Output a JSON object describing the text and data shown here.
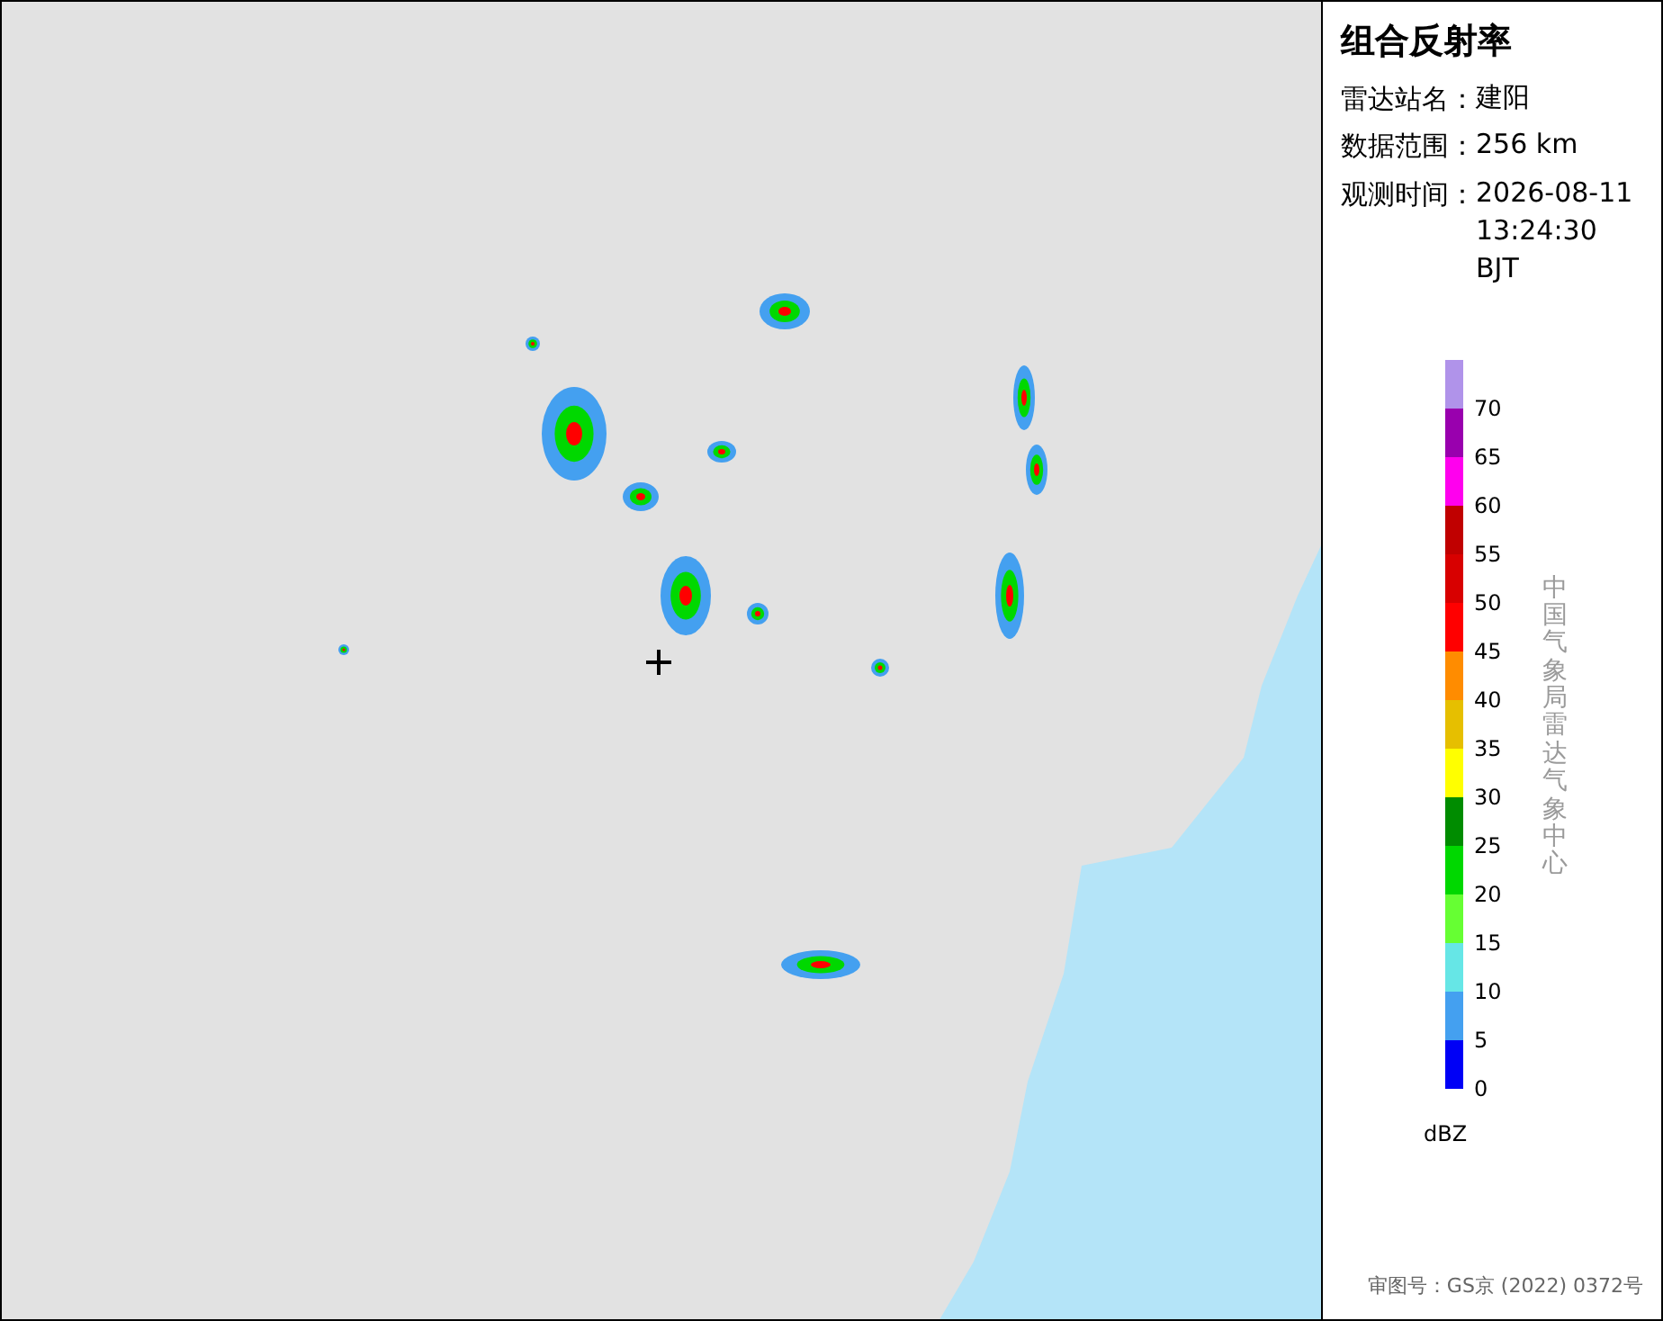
{
  "panel": {
    "title": "组合反射率",
    "fields": [
      {
        "label": "雷达站名：",
        "value": "建阳"
      },
      {
        "label": "数据范围：",
        "value": "256 km"
      },
      {
        "label": "观测时间：",
        "value": "2026-08-11 13:24:30 BJT"
      }
    ]
  },
  "legend": {
    "unit": "dBZ",
    "bins": [
      {
        "label": "70",
        "color": "#b093ea"
      },
      {
        "label": "65",
        "color": "#9900ae"
      },
      {
        "label": "60",
        "color": "#ff00ee"
      },
      {
        "label": "55",
        "color": "#c00000"
      },
      {
        "label": "50",
        "color": "#d80000"
      },
      {
        "label": "45",
        "color": "#ff0000"
      },
      {
        "label": "40",
        "color": "#ff8c00"
      },
      {
        "label": "35",
        "color": "#e6bf00"
      },
      {
        "label": "30",
        "color": "#ffff00"
      },
      {
        "label": "25",
        "color": "#008c00"
      },
      {
        "label": "20",
        "color": "#00d800"
      },
      {
        "label": "15",
        "color": "#66ff33"
      },
      {
        "label": "10",
        "color": "#66e6e6"
      },
      {
        "label": "5",
        "color": "#44a0f0"
      },
      {
        "label": "0",
        "color": "#0000f6"
      }
    ]
  },
  "credit": "中国气象局雷达气象中心",
  "approval": "审图号：GS京 (2022) 0372号"
}
